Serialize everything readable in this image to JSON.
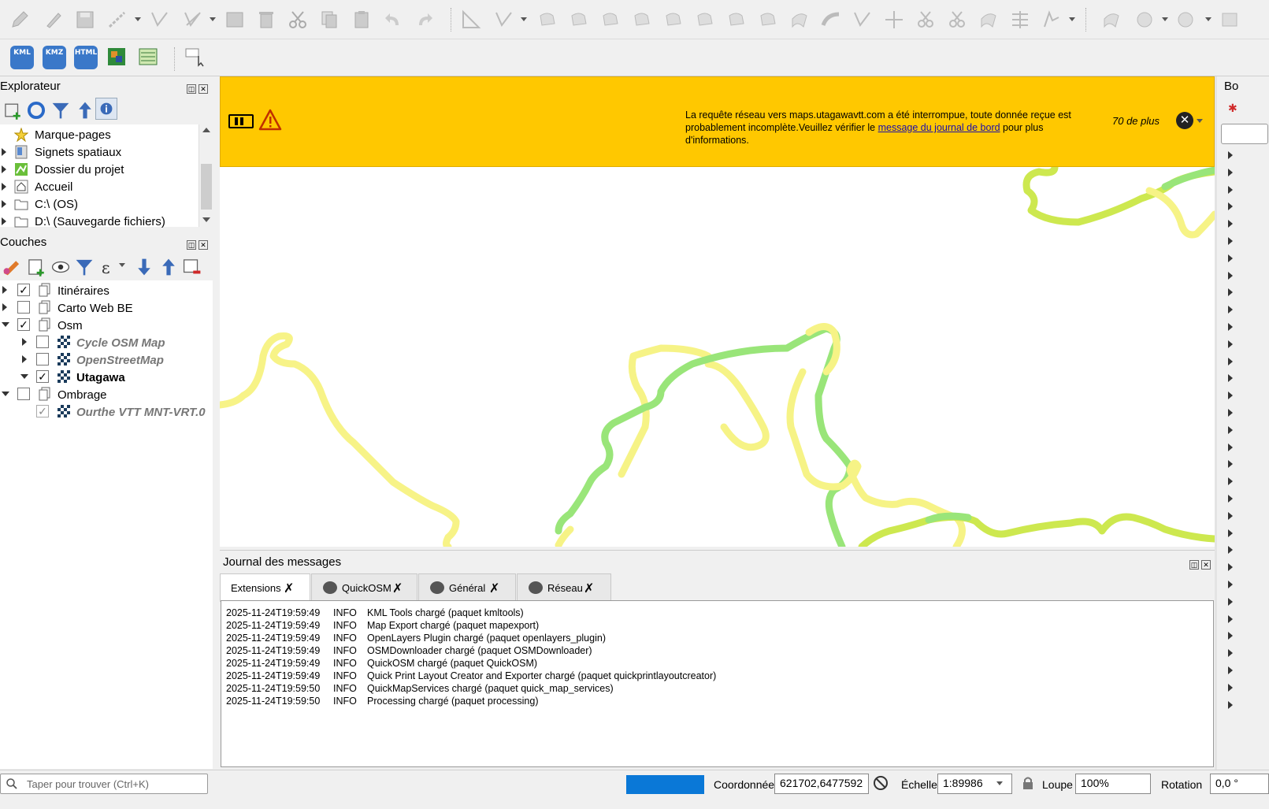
{
  "explorer": {
    "title": "Explorateur",
    "items": [
      "Marque-pages",
      "Signets spatiaux",
      "Dossier du projet",
      "Accueil",
      "C:\\ (OS)",
      "D:\\ (Sauvegarde fichiers)"
    ]
  },
  "layers": {
    "title": "Couches",
    "items": [
      {
        "label": "Itinéraires",
        "checked": true
      },
      {
        "label": "Carto Web BE",
        "checked": false
      },
      {
        "label": "Osm",
        "checked": true
      },
      {
        "label": "Cycle OSM Map",
        "checked": false
      },
      {
        "label": "OpenStreetMap",
        "checked": false
      },
      {
        "label": "Utagawa",
        "checked": true
      },
      {
        "label": "Ombrage",
        "checked": false
      },
      {
        "label": "Ourthe VTT MNT-VRT.0",
        "checked": true
      }
    ]
  },
  "plugins_toolbar": {
    "kml": "KML",
    "kmz": "KMZ",
    "html": "HTML"
  },
  "message_bar": {
    "text_before": "La requête réseau vers maps.utagawavtt.com a été interrompue, toute donnée reçue est probablement incomplète.Veuillez vérifier le",
    "link": "message du journal de bord",
    "text_after": "pour plus d'informations.",
    "more": "70 de plus"
  },
  "log_panel": {
    "title": "Journal des messages",
    "tabs": [
      "Extensions",
      "QuickOSM",
      "Général",
      "Réseau"
    ],
    "entries": [
      {
        "time": "2025-11-24T19:59:49",
        "level": "INFO",
        "text": "KML Tools chargé (paquet kmltools)"
      },
      {
        "time": "2025-11-24T19:59:49",
        "level": "INFO",
        "text": "Map Export chargé (paquet mapexport)"
      },
      {
        "time": "2025-11-24T19:59:49",
        "level": "INFO",
        "text": "OpenLayers Plugin chargé (paquet openlayers_plugin)"
      },
      {
        "time": "2025-11-24T19:59:49",
        "level": "INFO",
        "text": "OSMDownloader chargé (paquet OSMDownloader)"
      },
      {
        "time": "2025-11-24T19:59:49",
        "level": "INFO",
        "text": "QuickOSM chargé (paquet QuickOSM)"
      },
      {
        "time": "2025-11-24T19:59:49",
        "level": "INFO",
        "text": "Quick Print Layout Creator and Exporter chargé (paquet quickprintlayoutcreator)"
      },
      {
        "time": "2025-11-24T19:59:50",
        "level": "INFO",
        "text": "QuickMapServices chargé (paquet quick_map_services)"
      },
      {
        "time": "2025-11-24T19:59:50",
        "level": "INFO",
        "text": "Processing chargé (paquet processing)"
      }
    ]
  },
  "right_panel": {
    "title_fragment": "Bo"
  },
  "status_bar": {
    "search_placeholder": "Taper pour trouver (Ctrl+K)",
    "coord_label": "Coordonnée",
    "coord_value": "621702,6477592",
    "scale_label": "Échelle",
    "scale_value": "1:89986",
    "zoom_label": "Loupe",
    "zoom_value": "100%",
    "rotation_label": "Rotation",
    "rotation_value": "0,0 °"
  },
  "colors": {
    "message_bar": "#ffc800",
    "route_yellow": "#f6f27a",
    "route_lime": "#c8e63c",
    "route_green": "#8fe36b"
  }
}
